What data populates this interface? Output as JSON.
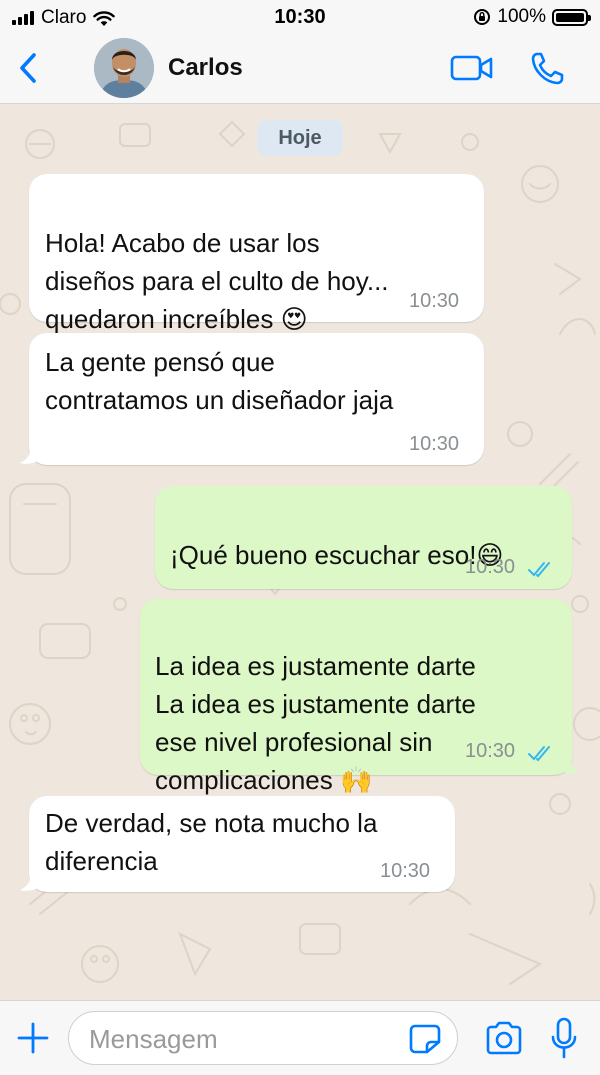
{
  "status_bar": {
    "carrier": "Claro",
    "time": "10:30",
    "battery": "100%"
  },
  "header": {
    "contact_name": "Carlos"
  },
  "chat": {
    "date_chip": "Hoje",
    "messages": [
      {
        "direction": "incoming",
        "text": "Hola! Acabo de usar los\ndiseños para el  culto de hoy...\nquedaron increíbles",
        "emoji": "😍",
        "time": "10:30"
      },
      {
        "direction": "incoming",
        "text": "La gente pensó que\ncontratamos un diseñador jaja",
        "time": "10:30"
      },
      {
        "direction": "outgoing",
        "text": "¡Qué bueno escuchar eso!",
        "emoji": "😄",
        "time": "10:30",
        "status": "read"
      },
      {
        "direction": "outgoing",
        "text": "La idea es justamente darte\nLa idea es justamente darte\nese nivel profesional sin\ncomplicaciones",
        "emoji": "🙌",
        "time": "10:30",
        "status": "read"
      },
      {
        "direction": "incoming",
        "text": "De verdad, se nota mucho la\ndiferencia",
        "time": "10:30"
      }
    ]
  },
  "input": {
    "placeholder": "Mensagem"
  },
  "colors": {
    "accent": "#007aff",
    "outgoing_bubble": "#dcf8c6",
    "incoming_bubble": "#ffffff",
    "wallpaper": "#efe7dd",
    "read_ticks": "#34b7f1"
  }
}
